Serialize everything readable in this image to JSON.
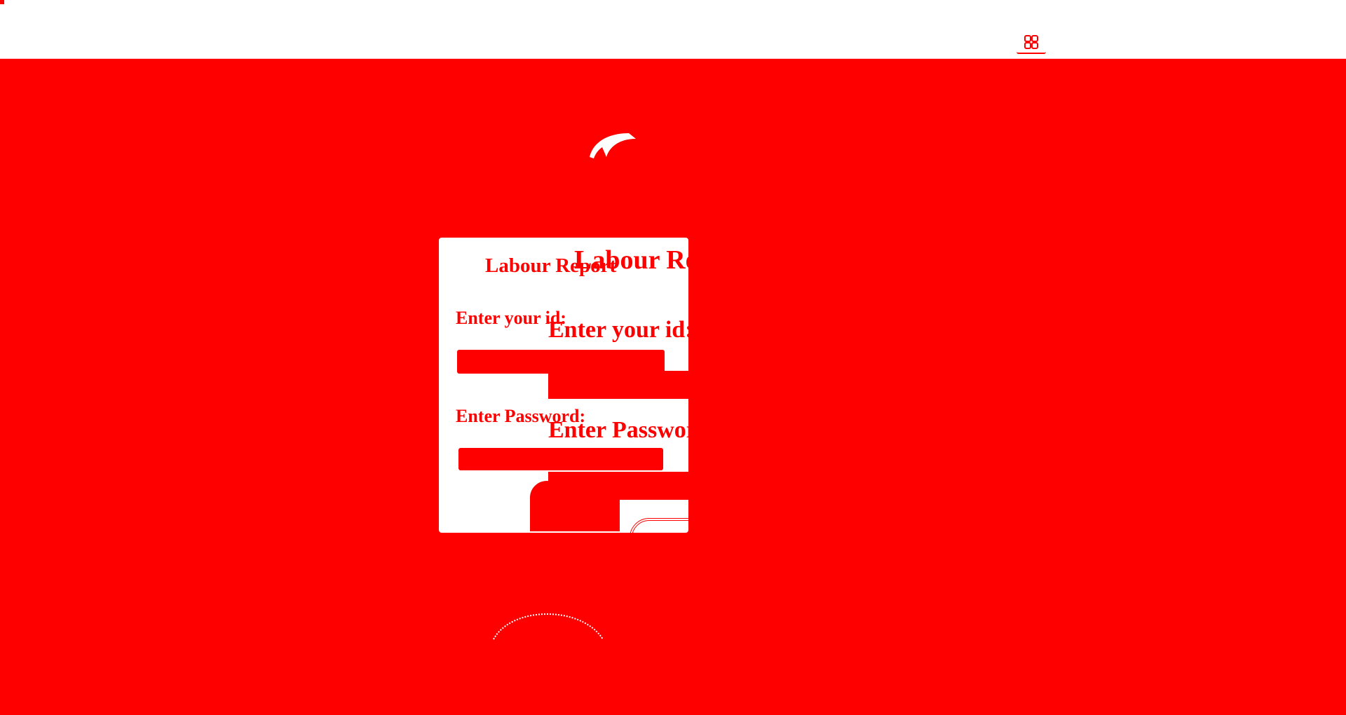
{
  "header": {
    "apps_icon": "apps-grid-icon"
  },
  "logo": {
    "icon": "swoosh-logo-icon"
  },
  "login_card": {
    "title": "Labour Report",
    "id_label": "Enter your id:",
    "id_value": "",
    "password_label": "Enter Password:",
    "password_value": "",
    "submit_label": ""
  },
  "colors": {
    "background": "#ff0000",
    "card": "#ffffff",
    "text": "#ff0000"
  }
}
